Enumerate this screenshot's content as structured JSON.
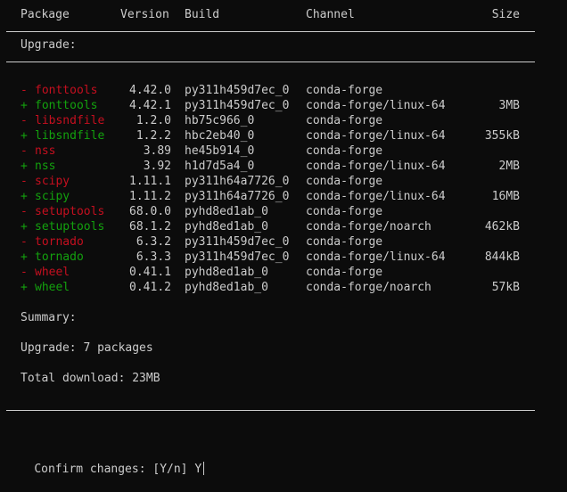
{
  "headers": {
    "package": "Package",
    "version": "Version",
    "build": "Build",
    "channel": "Channel",
    "size": "Size"
  },
  "section_label": "Upgrade:",
  "rows": [
    {
      "sign": "-",
      "action": "remove",
      "name": "fonttools",
      "version": "4.42.0",
      "build": "py311h459d7ec_0",
      "channel": "conda-forge",
      "size": ""
    },
    {
      "sign": "+",
      "action": "add",
      "name": "fonttools",
      "version": "4.42.1",
      "build": "py311h459d7ec_0",
      "channel": "conda-forge/linux-64",
      "size": "3MB"
    },
    {
      "sign": "-",
      "action": "remove",
      "name": "libsndfile",
      "version": "1.2.0",
      "build": "hb75c966_0",
      "channel": "conda-forge",
      "size": ""
    },
    {
      "sign": "+",
      "action": "add",
      "name": "libsndfile",
      "version": "1.2.2",
      "build": "hbc2eb40_0",
      "channel": "conda-forge/linux-64",
      "size": "355kB"
    },
    {
      "sign": "-",
      "action": "remove",
      "name": "nss",
      "version": "3.89",
      "build": "he45b914_0",
      "channel": "conda-forge",
      "size": ""
    },
    {
      "sign": "+",
      "action": "add",
      "name": "nss",
      "version": "3.92",
      "build": "h1d7d5a4_0",
      "channel": "conda-forge/linux-64",
      "size": "2MB"
    },
    {
      "sign": "-",
      "action": "remove",
      "name": "scipy",
      "version": "1.11.1",
      "build": "py311h64a7726_0",
      "channel": "conda-forge",
      "size": ""
    },
    {
      "sign": "+",
      "action": "add",
      "name": "scipy",
      "version": "1.11.2",
      "build": "py311h64a7726_0",
      "channel": "conda-forge/linux-64",
      "size": "16MB"
    },
    {
      "sign": "-",
      "action": "remove",
      "name": "setuptools",
      "version": "68.0.0",
      "build": "pyhd8ed1ab_0",
      "channel": "conda-forge",
      "size": ""
    },
    {
      "sign": "+",
      "action": "add",
      "name": "setuptools",
      "version": "68.1.2",
      "build": "pyhd8ed1ab_0",
      "channel": "conda-forge/noarch",
      "size": "462kB"
    },
    {
      "sign": "-",
      "action": "remove",
      "name": "tornado",
      "version": "6.3.2",
      "build": "py311h459d7ec_0",
      "channel": "conda-forge",
      "size": ""
    },
    {
      "sign": "+",
      "action": "add",
      "name": "tornado",
      "version": "6.3.3",
      "build": "py311h459d7ec_0",
      "channel": "conda-forge/linux-64",
      "size": "844kB"
    },
    {
      "sign": "-",
      "action": "remove",
      "name": "wheel",
      "version": "0.41.1",
      "build": "pyhd8ed1ab_0",
      "channel": "conda-forge",
      "size": ""
    },
    {
      "sign": "+",
      "action": "add",
      "name": "wheel",
      "version": "0.41.2",
      "build": "pyhd8ed1ab_0",
      "channel": "conda-forge/noarch",
      "size": "57kB"
    }
  ],
  "summary": {
    "label": "Summary:",
    "upgrade": "Upgrade: 7 packages",
    "download": "Total download: 23MB"
  },
  "prompt": {
    "text": "Confirm changes: [Y/n] ",
    "input": "Y"
  },
  "colors": {
    "background": "#0c0c0c",
    "foreground": "#cccccc",
    "remove": "#c50f1f",
    "add": "#13a10e"
  }
}
